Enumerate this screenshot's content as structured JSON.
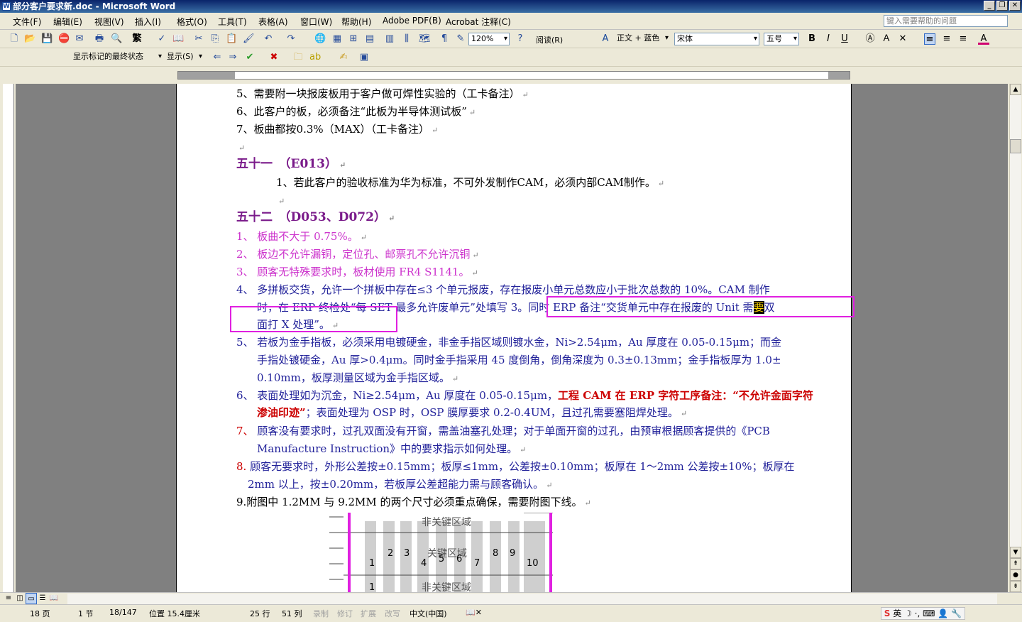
{
  "window": {
    "title": "部分客户要求新.doc - Microsoft Word",
    "buttons": [
      "_",
      "❐",
      "✕"
    ]
  },
  "menu": {
    "items": [
      "文件(F)",
      "编辑(E)",
      "视图(V)",
      "插入(I)",
      "格式(O)",
      "工具(T)",
      "表格(A)",
      "窗口(W)",
      "帮助(H)",
      "Adobe PDF(B)",
      "Acrobat 注释(C)"
    ],
    "help_placeholder": "键入需要帮助的问题"
  },
  "toolbar": {
    "zoom": "120%",
    "reading_label": "阅读(R)",
    "style": "正文 + 蓝色",
    "font": "宋体",
    "size": "五号",
    "bold": "B",
    "italic": "I",
    "underline": "U",
    "font_color_label": "A",
    "markup_state": "显示标记的最终状态",
    "show_menu": "显示(S)",
    "change_case": "繁"
  },
  "document": {
    "l1": "5、需要附一块报废板用于客户做可焊性实验的（工卡备注）",
    "l2": "6、此客户的板，必须备注“此板为半导体测试板”",
    "l3": "7、板曲都按0.3%（MAX）（工卡备注）",
    "h51": "五十一　（E013）",
    "h51_1": "1、若此客户的验收标准为华为标准，不可外发制作CAM，必须内部CAM制作。",
    "h52": "五十二　（D053、D072）",
    "p1": "1、 板曲不大于 0.75%。",
    "p2": "2、 板边不允许漏铜，定位孔、邮票孔不允许沉铜",
    "p3": "3、 顾客无特殊要求时，板材使用 FR4 S1141。",
    "p4a": "4、 多拼板交货，允许一个拼板中存在≤3 个单元报废，存在报废小单元总数应小于批次总数的 10%。CAM 制作",
    "p4b_1": "时，在 ERP 终检处“每 SET 最多允许废单元”处填写 3。同时 ERP 备注“交货单元中存在报废的 Unit 需",
    "p4b_hl": "要",
    "p4b_2": "双",
    "p4c": "面打 X 处理”。",
    "p5a": "5、 若板为金手指板，必须采用电镀硬金，非金手指区域则镀水金，Ni>2.54μm，Au 厚度在 0.05-0.15μm；而金",
    "p5b": "手指处镀硬金，Au 厚>0.4μm。同时金手指采用 45 度倒角，倒角深度为 0.3±0.13mm；金手指板厚为 1.0±",
    "p5c": "0.10mm，板厚测量区域为金手指区域。",
    "p6a_1": "6、 表面处理如为沉金，Ni≥2.54μm，Au 厚度在 0.05-0.15μm，",
    "p6a_2": "工程 CAM 在 ERP 字符工序备注：“不允许金面字符",
    "p6b_1": "渗油印迹”",
    "p6b_2": "；表面处理为 OSP 时，OSP 膜厚要求 0.2-0.4UM，且过孔需要塞阻焊处理。",
    "p7a_num": "7、",
    "p7a": " 顾客没有要求时，过孔双面没有开窗，需盖油塞孔处理；对于单面开窗的过孔，由预审根据顾客提供的《PCB",
    "p7b": "Manufacture Instruction》中的要求指示如何处理。",
    "p8a_num": "8.",
    "p8a": " 顾客无要求时，外形公差按±0.15mm；板厚≤1mm，公差按±0.10mm；板厚在 1～2mm 公差按±10%；板厚在",
    "p8b": "2mm 以上，按±0.20mm，若板厚公差超能力需与顾客确认。",
    "p9": "9.附图中 1.2MM 与 9.2MM 的两个尺寸必须重点确保，需要附图下线。",
    "para_mark": "↵"
  },
  "figure": {
    "top_label": "非关键区域",
    "mid_label": "关键区域",
    "bottom_label": "非关键区域",
    "numbers": [
      "1",
      "2",
      "3",
      "4",
      "5",
      "6",
      "7",
      "8",
      "9",
      "10"
    ],
    "bottom_number": "1"
  },
  "status": {
    "page": "18 页",
    "section": "1 节",
    "pages": "18/147",
    "position": "位置 15.4厘米",
    "row": "25 行",
    "col": "51 列",
    "rec": "录制",
    "trk": "修订",
    "ext": "扩展",
    "ovr": "改写",
    "language": "中文(中国)",
    "ime": "英"
  },
  "colors": {
    "markup_box": "#e020e0",
    "heading": "#7a1a8a",
    "magenta_text": "#cc33cc",
    "blue_text": "#22229a",
    "red_text": "#cc0000"
  }
}
